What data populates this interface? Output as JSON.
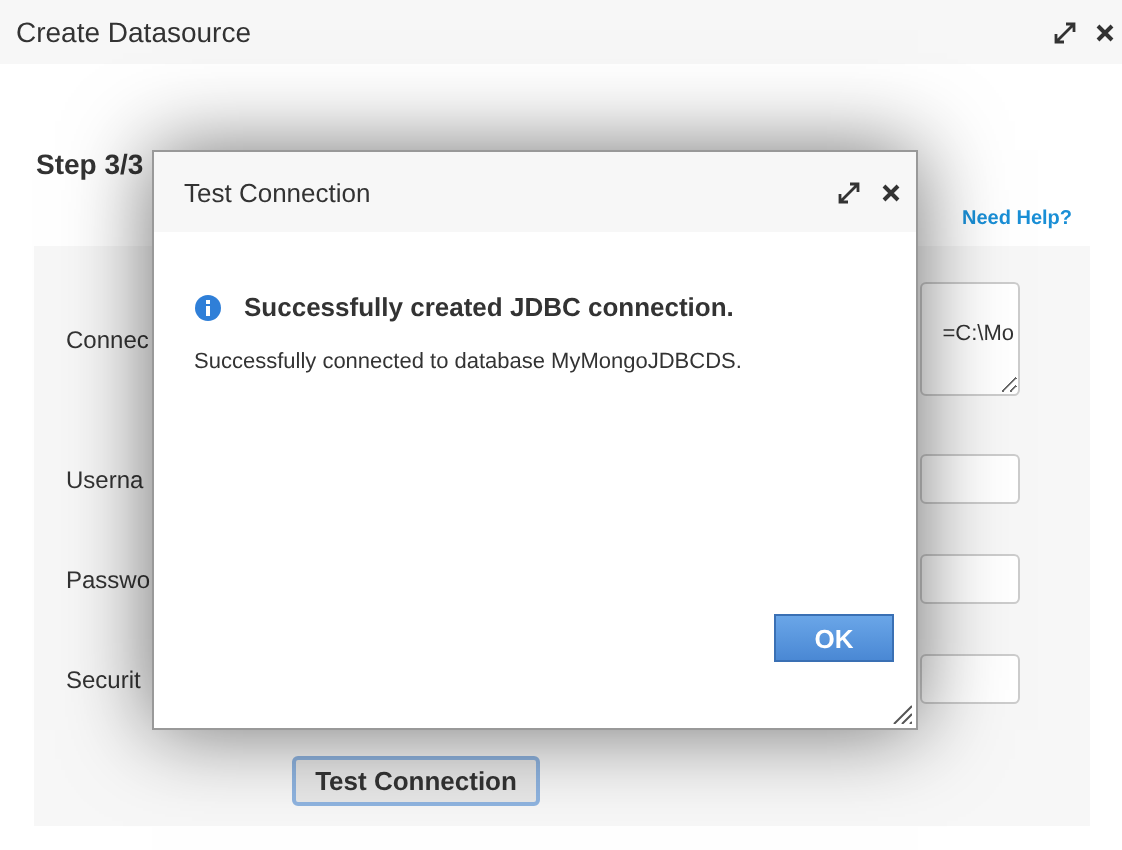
{
  "window": {
    "title": "Create Datasource"
  },
  "step": "Step 3/3",
  "help_link": "Need Help?",
  "form": {
    "fields": [
      {
        "label": "Connec",
        "kind": "textarea",
        "value": "=C:\\Mo"
      },
      {
        "label": "Userna",
        "kind": "input"
      },
      {
        "label": "Passwo",
        "kind": "input"
      },
      {
        "label": "Securit",
        "kind": "input"
      }
    ],
    "test_button": "Test Connection"
  },
  "dialog": {
    "title": "Test Connection",
    "heading": "Successfully created JDBC connection.",
    "message": "Successfully connected to database MyMongoJDBCDS.",
    "ok_button": "OK"
  }
}
